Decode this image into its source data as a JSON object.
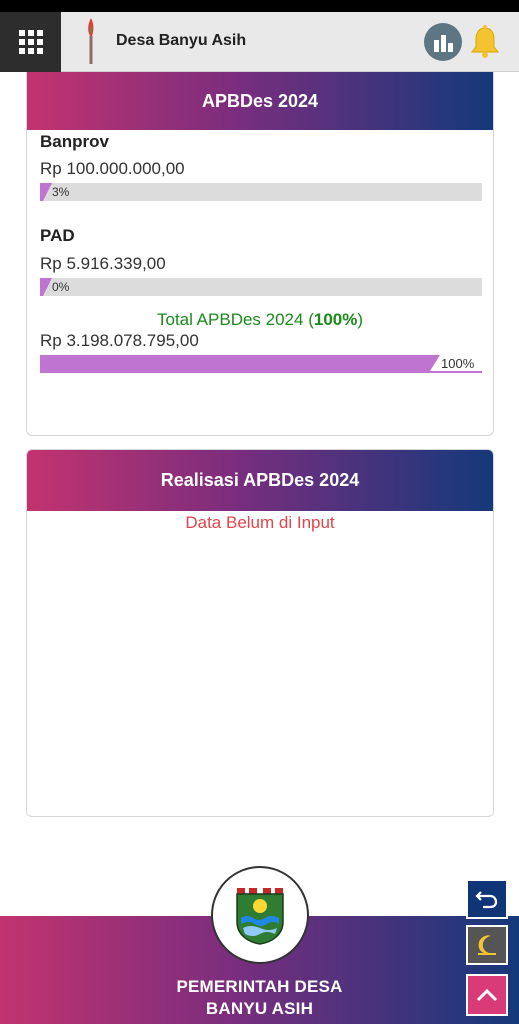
{
  "header": {
    "app_title": "Desa Banyu Asih",
    "icons": [
      "grid-menu-icon",
      "torch-logo-icon",
      "bar-chart-icon",
      "bell-icon"
    ]
  },
  "apbdes": {
    "title": "APBDes 2024",
    "items": [
      {
        "name": "Banprov",
        "amount": "Rp 100.000.000,00",
        "percent_label": "3%",
        "percent": 3
      },
      {
        "name": "PAD",
        "amount": "Rp 5.916.339,00",
        "percent_label": "0%",
        "percent": 0
      }
    ],
    "total": {
      "label": "Total APBDes 2024 (",
      "percent_label": "100%",
      "suffix": ")",
      "amount": "Rp 3.198.078.795,00",
      "bar_label": "100%",
      "percent": 100
    }
  },
  "realisasi": {
    "title": "Realisasi APBDes 2024",
    "message": "Data Belum di Input"
  },
  "footer": {
    "line1": "PEMERINTAH DESA",
    "line2": "BANYU ASIH",
    "icons": [
      "village-emblem-icon"
    ]
  },
  "fabs": {
    "icons": [
      "back-arrow-icon",
      "moon-icon",
      "chevron-up-icon"
    ]
  },
  "colors": {
    "gradient_start": "#c2336f",
    "gradient_end": "#14397a",
    "bar_fill": "#c074d1",
    "total_green": "#1b8a1b",
    "empty_red": "#e0454b"
  }
}
